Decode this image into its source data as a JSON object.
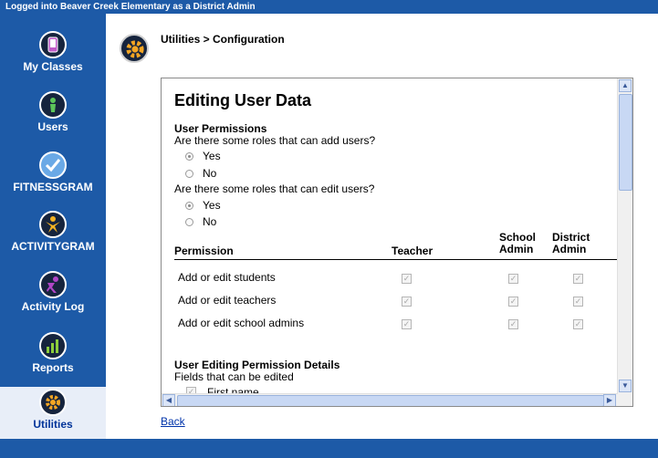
{
  "top_bar": {
    "status": "Logged into Beaver Creek Elementary as a District Admin"
  },
  "sidebar": {
    "items": [
      {
        "label": "My Classes",
        "icon": "phone-icon"
      },
      {
        "label": "Users",
        "icon": "person-icon"
      },
      {
        "label": "FITNESSGRAM",
        "icon": "checkmark-icon"
      },
      {
        "label": "ACTIVITYGRAM",
        "icon": "star-person-icon"
      },
      {
        "label": "Activity Log",
        "icon": "runner-icon"
      },
      {
        "label": "Reports",
        "icon": "bar-chart-icon"
      },
      {
        "label": "Utilities",
        "icon": "gear-icon",
        "active": true
      }
    ]
  },
  "header": {
    "breadcrumb": "Utilities > Configuration"
  },
  "editor": {
    "title": "Editing User Data",
    "user_permissions": {
      "heading": "User Permissions",
      "q_add": "Are there some roles that can add users?",
      "q_add_yes": "Yes",
      "q_add_no": "No",
      "q_add_value": "Yes",
      "q_edit": "Are there some roles that can edit users?",
      "q_edit_yes": "Yes",
      "q_edit_no": "No",
      "q_edit_value": "Yes"
    },
    "table": {
      "col_permission": "Permission",
      "col_teacher": "Teacher",
      "col_school_admin": [
        "School",
        "Admin"
      ],
      "col_district_admin": [
        "District",
        "Admin"
      ],
      "rows": [
        {
          "label": "Add or edit students",
          "teacher": true,
          "school_admin": true,
          "district_admin": true
        },
        {
          "label": "Add or edit teachers",
          "teacher": true,
          "school_admin": true,
          "district_admin": true
        },
        {
          "label": "Add or edit school admins",
          "teacher": true,
          "school_admin": true,
          "district_admin": true
        }
      ]
    },
    "details": {
      "heading": "User Editing Permission Details",
      "subheading": "Fields that can be edited",
      "first_item": "First name"
    }
  },
  "footer": {
    "back_label": "Back"
  },
  "colors": {
    "chrome_blue": "#1d5aa7",
    "link": "#0033aa"
  }
}
